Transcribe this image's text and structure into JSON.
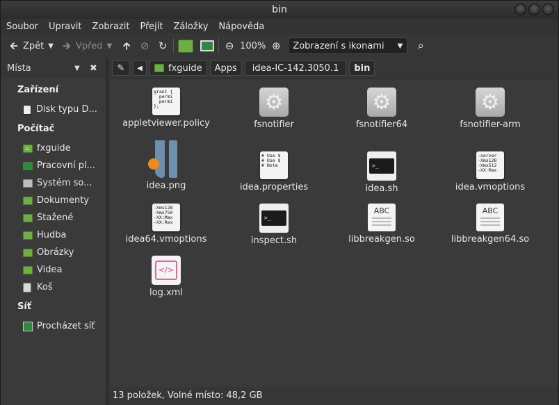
{
  "window": {
    "title": "bin"
  },
  "menubar": [
    "Soubor",
    "Upravit",
    "Zobrazit",
    "Přejít",
    "Záložky",
    "Nápověda"
  ],
  "toolbar": {
    "back_label": "Zpět",
    "forward_label": "Vpřed",
    "zoom_level": "100%",
    "view_mode": "Zobrazení s ikonami"
  },
  "sidebar": {
    "header": "Místa",
    "sections": [
      {
        "title": "Zařízení",
        "items": [
          {
            "label": "Disk typu D...",
            "icon": "drive-icon"
          }
        ]
      },
      {
        "title": "Počítač",
        "items": [
          {
            "label": "fxguide",
            "icon": "home-folder-icon"
          },
          {
            "label": "Pracovní pl...",
            "icon": "desktop-folder-icon"
          },
          {
            "label": "Systém so...",
            "icon": "filesystem-icon"
          },
          {
            "label": "Dokumenty",
            "icon": "documents-folder-icon"
          },
          {
            "label": "Stažené",
            "icon": "downloads-folder-icon"
          },
          {
            "label": "Hudba",
            "icon": "music-folder-icon"
          },
          {
            "label": "Obrázky",
            "icon": "pictures-folder-icon"
          },
          {
            "label": "Videa",
            "icon": "videos-folder-icon"
          },
          {
            "label": "Koš",
            "icon": "trash-icon"
          }
        ]
      },
      {
        "title": "Síť",
        "items": [
          {
            "label": "Procházet síť",
            "icon": "network-icon"
          }
        ]
      }
    ]
  },
  "pathbar": {
    "crumbs": [
      "fxguide",
      "Apps",
      "idea-IC-142.3050.1",
      "bin"
    ]
  },
  "files": [
    {
      "name": "appletviewer.policy",
      "kind": "text",
      "preview": "grant {\n  permi\n  permi\n};"
    },
    {
      "name": "fsnotifier",
      "kind": "executable"
    },
    {
      "name": "fsnotifier64",
      "kind": "executable"
    },
    {
      "name": "fsnotifier-arm",
      "kind": "executable"
    },
    {
      "name": "idea.png",
      "kind": "image"
    },
    {
      "name": "idea.properties",
      "kind": "text",
      "preview": "# Use $\n# Use $\n# Note"
    },
    {
      "name": "idea.sh",
      "kind": "script",
      "preview": ">_"
    },
    {
      "name": "idea.vmoptions",
      "kind": "text",
      "preview": "-server\n-Xms128\n-Xmx512\n-XX:Max"
    },
    {
      "name": "idea64.vmoptions",
      "kind": "text",
      "preview": "-Xms128\n-Xmx750\n-XX:Max\n-XX:Res"
    },
    {
      "name": "inspect.sh",
      "kind": "script",
      "preview": ">_"
    },
    {
      "name": "libbreakgen.so",
      "kind": "library",
      "preview": "ABC"
    },
    {
      "name": "libbreakgen64.so",
      "kind": "library",
      "preview": "ABC"
    },
    {
      "name": "log.xml",
      "kind": "xml",
      "preview": "</>"
    }
  ],
  "status": "13 položek, Volné místo: 48,2 GB"
}
